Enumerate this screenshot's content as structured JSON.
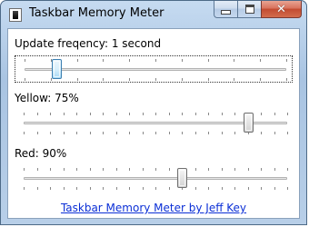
{
  "window": {
    "title": "Taskbar Memory Meter",
    "icon": "app-icon",
    "controls": {
      "minimize": "minimize-icon",
      "maximize": "maximize-icon",
      "close": "close-icon"
    }
  },
  "update_frequency": {
    "label": "Update freqency: 1 second",
    "value_fraction": 0.12,
    "tick_count": 11,
    "focused": true
  },
  "yellow": {
    "label": "Yellow: 75%",
    "value_fraction": 0.85,
    "tick_count": 21
  },
  "red": {
    "label": "Red: 90%",
    "value_fraction": 0.6,
    "tick_count": 21
  },
  "footer": {
    "link_text": "Taskbar Memory Meter by Jeff Key"
  },
  "colors": {
    "link": "#0b2fd6",
    "close_button": "#c24b31",
    "active_thumb": "#a7d9f5"
  }
}
